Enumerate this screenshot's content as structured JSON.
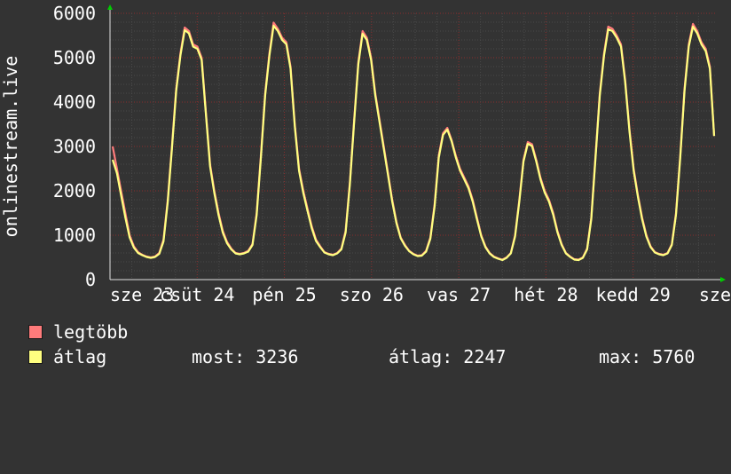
{
  "chart_data": {
    "type": "line",
    "ylabel": "onlinestream.live",
    "ylim": [
      0,
      6000
    ],
    "yticks": [
      0,
      1000,
      2000,
      3000,
      4000,
      5000,
      6000
    ],
    "xticks": [
      "sze 23",
      "csüt 24",
      "pén 25",
      "szo 26",
      "vas 27",
      "hét 28",
      "kedd 29",
      "sze"
    ],
    "colors": {
      "legtobb": "#ff7b7b",
      "atlag": "#ffff80",
      "grid": "#8a2e2e",
      "axis": "#e0e0e0",
      "arrow": "#00cc00"
    },
    "series": [
      {
        "name": "legtöbb",
        "values": [
          3000,
          2500,
          2000,
          1500,
          1000,
          750,
          620,
          560,
          520,
          500,
          520,
          600,
          900,
          1800,
          3000,
          4300,
          5100,
          5680,
          5600,
          5300,
          5250,
          5000,
          3800,
          2600,
          2000,
          1500,
          1100,
          850,
          700,
          600,
          580,
          600,
          650,
          800,
          1500,
          2800,
          4200,
          5100,
          5790,
          5650,
          5450,
          5350,
          4800,
          3500,
          2500,
          2000,
          1600,
          1200,
          900,
          750,
          620,
          580,
          560,
          600,
          700,
          1100,
          2200,
          3600,
          4900,
          5600,
          5450,
          5000,
          4200,
          3600,
          3000,
          2400,
          1800,
          1300,
          950,
          780,
          650,
          580,
          540,
          550,
          650,
          950,
          1700,
          2800,
          3300,
          3420,
          3150,
          2800,
          2500,
          2300,
          2100,
          1800,
          1400,
          1000,
          750,
          600,
          520,
          480,
          450,
          500,
          600,
          1000,
          1800,
          2700,
          3100,
          3050,
          2700,
          2300,
          2000,
          1800,
          1500,
          1100,
          800,
          600,
          520,
          460,
          450,
          500,
          700,
          1400,
          2800,
          4200,
          5100,
          5700,
          5650,
          5500,
          5300,
          4500,
          3400,
          2500,
          1900,
          1400,
          1000,
          750,
          620,
          580,
          560,
          600,
          800,
          1500,
          2800,
          4300,
          5300,
          5760,
          5600,
          5350,
          5200,
          4800,
          3236
        ]
      },
      {
        "name": "átlag",
        "values": [
          2700,
          2400,
          1900,
          1400,
          950,
          720,
          600,
          550,
          510,
          490,
          510,
          580,
          860,
          1750,
          2950,
          4250,
          5050,
          5620,
          5550,
          5250,
          5200,
          4950,
          3750,
          2550,
          1950,
          1450,
          1060,
          820,
          680,
          590,
          570,
          590,
          630,
          780,
          1450,
          2750,
          4150,
          5050,
          5720,
          5600,
          5400,
          5300,
          4750,
          3450,
          2450,
          1950,
          1550,
          1160,
          870,
          730,
          610,
          570,
          550,
          590,
          680,
          1060,
          2150,
          3550,
          4850,
          5540,
          5400,
          4950,
          4150,
          3550,
          2950,
          2350,
          1760,
          1270,
          930,
          760,
          640,
          570,
          530,
          540,
          630,
          920,
          1650,
          2750,
          3260,
          3380,
          3120,
          2760,
          2460,
          2260,
          2060,
          1760,
          1360,
          980,
          730,
          590,
          510,
          470,
          440,
          490,
          590,
          970,
          1760,
          2660,
          3060,
          3010,
          2660,
          2260,
          1960,
          1760,
          1460,
          1070,
          780,
          590,
          510,
          450,
          440,
          490,
          680,
          1360,
          2750,
          4150,
          5050,
          5640,
          5600,
          5450,
          5250,
          4450,
          3350,
          2450,
          1860,
          1360,
          970,
          730,
          610,
          570,
          550,
          590,
          780,
          1460,
          2750,
          4250,
          5250,
          5700,
          5550,
          5300,
          5150,
          4750,
          3236
        ]
      }
    ],
    "legend": [
      {
        "key": "legtobb",
        "label": "legtöbb"
      },
      {
        "key": "atlag",
        "label": "átlag"
      }
    ],
    "stats": {
      "most": "most: 3236",
      "atlag": "átlag: 2247",
      "max": "max: 5760"
    }
  }
}
